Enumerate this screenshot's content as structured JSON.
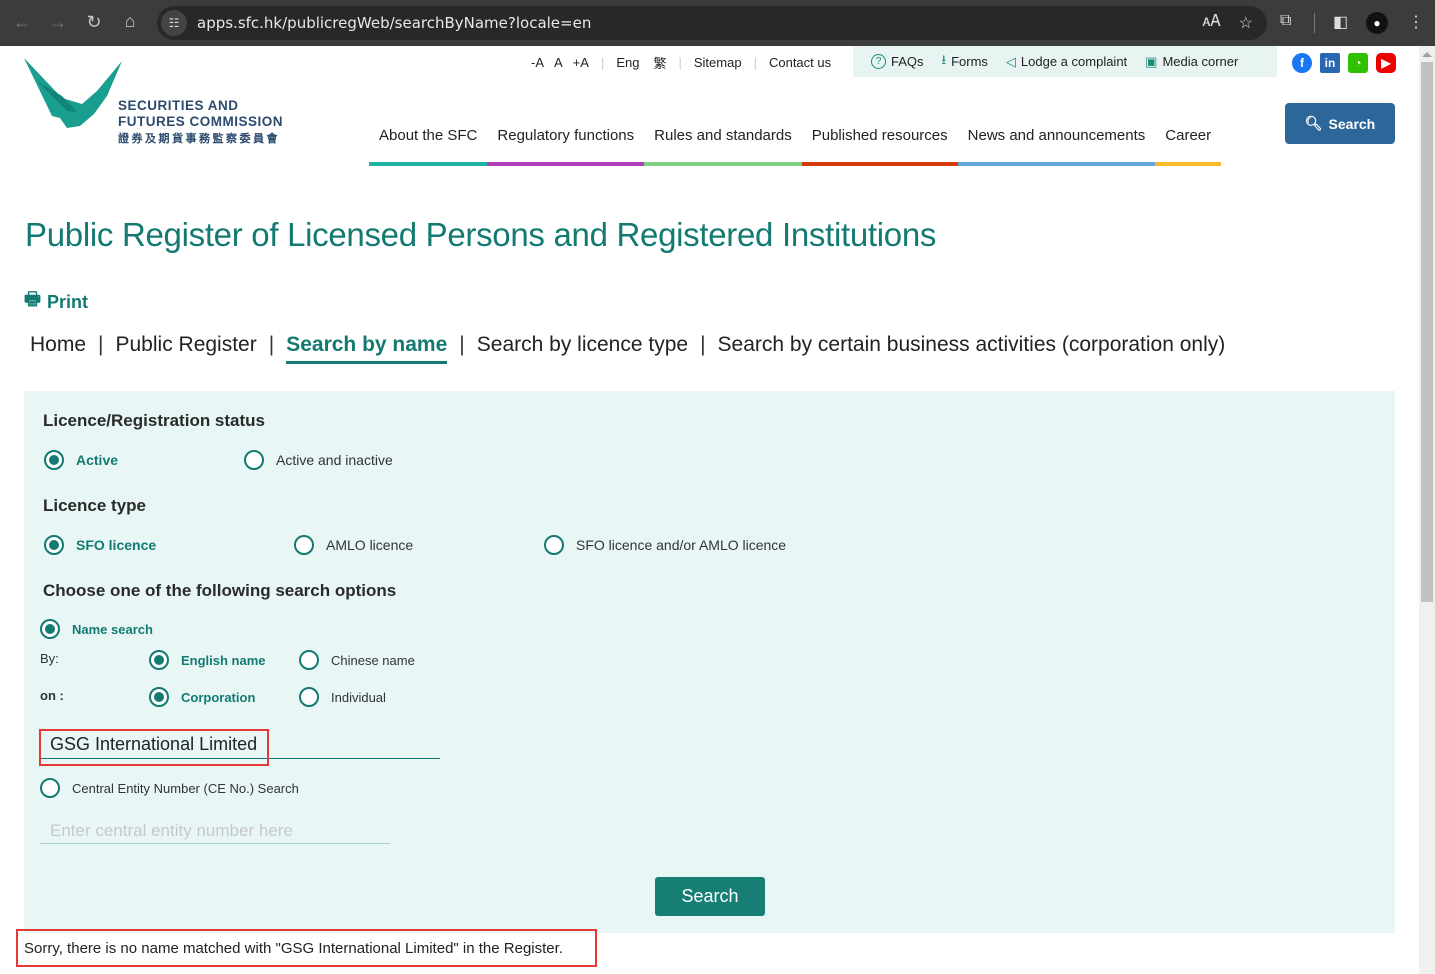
{
  "browser": {
    "url": "apps.sfc.hk/publicregWeb/searchByName?locale=en",
    "icons": [
      "back-icon",
      "forward-icon",
      "reload-icon",
      "home-icon",
      "site-settings-icon",
      "translate-icon",
      "bookmark-star-icon",
      "extensions-icon",
      "side-panel-icon",
      "profile-icon",
      "menu-icon"
    ]
  },
  "logo": {
    "line1": "SECURITIES AND",
    "line2": "FUTURES COMMISSION",
    "chinese": "證券及期貨事務監察委員會"
  },
  "utility": {
    "font_small": "-A",
    "font_normal": "A",
    "font_large": "+A",
    "lang_en": "Eng",
    "lang_tc": "繁",
    "sitemap": "Sitemap",
    "contact": "Contact us"
  },
  "quick_links": [
    {
      "icon": "question-circle-icon",
      "glyph": "?",
      "label": "FAQs"
    },
    {
      "icon": "download-icon",
      "glyph": "⭳",
      "label": "Forms"
    },
    {
      "icon": "megaphone-icon",
      "glyph": "📢",
      "label": "Lodge a complaint"
    },
    {
      "icon": "image-icon",
      "glyph": "▣",
      "label": "Media corner"
    }
  ],
  "social": [
    {
      "name": "facebook-icon",
      "glyph": "f"
    },
    {
      "name": "linkedin-icon",
      "glyph": "in"
    },
    {
      "name": "wechat-icon",
      "glyph": "◔"
    },
    {
      "name": "youtube-icon",
      "glyph": "▶"
    }
  ],
  "main_nav": [
    {
      "label": "About the SFC",
      "color": "#1fb3a4"
    },
    {
      "label": "Regulatory functions",
      "color": "#b040b8"
    },
    {
      "label": "Rules and standards",
      "color": "#7fcf80"
    },
    {
      "label": "Published resources",
      "color": "#d83a10"
    },
    {
      "label": "News and announcements",
      "color": "#62a8d8"
    },
    {
      "label": "Career",
      "color": "#fbb828"
    }
  ],
  "top_search_label": "Search",
  "page_title": "Public Register of Licensed Persons and Registered Institutions",
  "print_label": "Print",
  "breadcrumb": [
    {
      "label": "Home",
      "active": false
    },
    {
      "label": "Public Register",
      "active": false
    },
    {
      "label": "Search by name",
      "active": true
    },
    {
      "label": "Search by licence type",
      "active": false
    },
    {
      "label": "Search by certain business activities (corporation only)",
      "active": false
    }
  ],
  "form": {
    "status_heading": "Licence/Registration status",
    "status_options": [
      {
        "label": "Active",
        "selected": true
      },
      {
        "label": "Active and inactive",
        "selected": false
      }
    ],
    "type_heading": "Licence type",
    "type_options": [
      {
        "label": "SFO licence",
        "selected": true
      },
      {
        "label": "AMLO licence",
        "selected": false
      },
      {
        "label": "SFO licence and/or AMLO licence",
        "selected": false
      }
    ],
    "options_heading": "Choose one of the following search options",
    "name_search_label": "Name search",
    "name_search_selected": true,
    "by_label": "By:",
    "by_options": [
      {
        "label": "English name",
        "selected": true
      },
      {
        "label": "Chinese name",
        "selected": false
      }
    ],
    "on_label": "on :",
    "on_options": [
      {
        "label": "Corporation",
        "selected": true
      },
      {
        "label": "Individual",
        "selected": false
      }
    ],
    "name_value": "GSG International Limited",
    "ce_search_label": "Central Entity Number (CE No.) Search",
    "ce_search_selected": false,
    "ce_placeholder": "Enter central entity number here",
    "ce_value": "",
    "search_button": "Search"
  },
  "result_message": "Sorry, there is no name matched with \"GSG International Limited\" in the Register."
}
